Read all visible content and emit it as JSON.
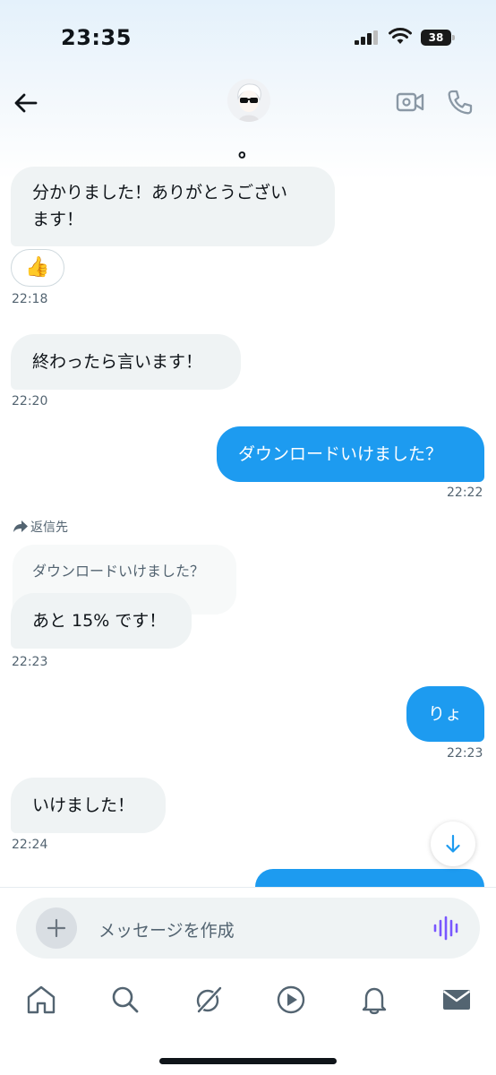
{
  "status_bar": {
    "time": "23:35",
    "battery": "38"
  },
  "header": {
    "contact_name": "。"
  },
  "messages": [
    {
      "side": "in",
      "lines": [
        "分かりました！ありがとうござい",
        "ます！"
      ],
      "time": "22:18",
      "reaction": "👍"
    },
    {
      "side": "in",
      "text": "終わったら言います！",
      "time": "22:20"
    },
    {
      "side": "out",
      "text": "ダウンロードいけました？",
      "time": "22:22"
    },
    {
      "side": "in",
      "reply_label": "返信先",
      "quoted": "ダウンロードいけました？",
      "text": "あと 15% です！",
      "time": "22:23"
    },
    {
      "side": "out",
      "text": "りょ",
      "time": "22:23"
    },
    {
      "side": "in",
      "text": "いけました！",
      "time": "22:24"
    }
  ],
  "composer": {
    "placeholder": "メッセージを作成"
  },
  "tabs": [
    "home-icon",
    "search-icon",
    "grok-icon",
    "video-icon",
    "notifications-icon",
    "messages-icon"
  ],
  "colors": {
    "accent": "#1d9bf0",
    "incoming_bubble": "#eff3f4",
    "voice": "#7856ff"
  }
}
